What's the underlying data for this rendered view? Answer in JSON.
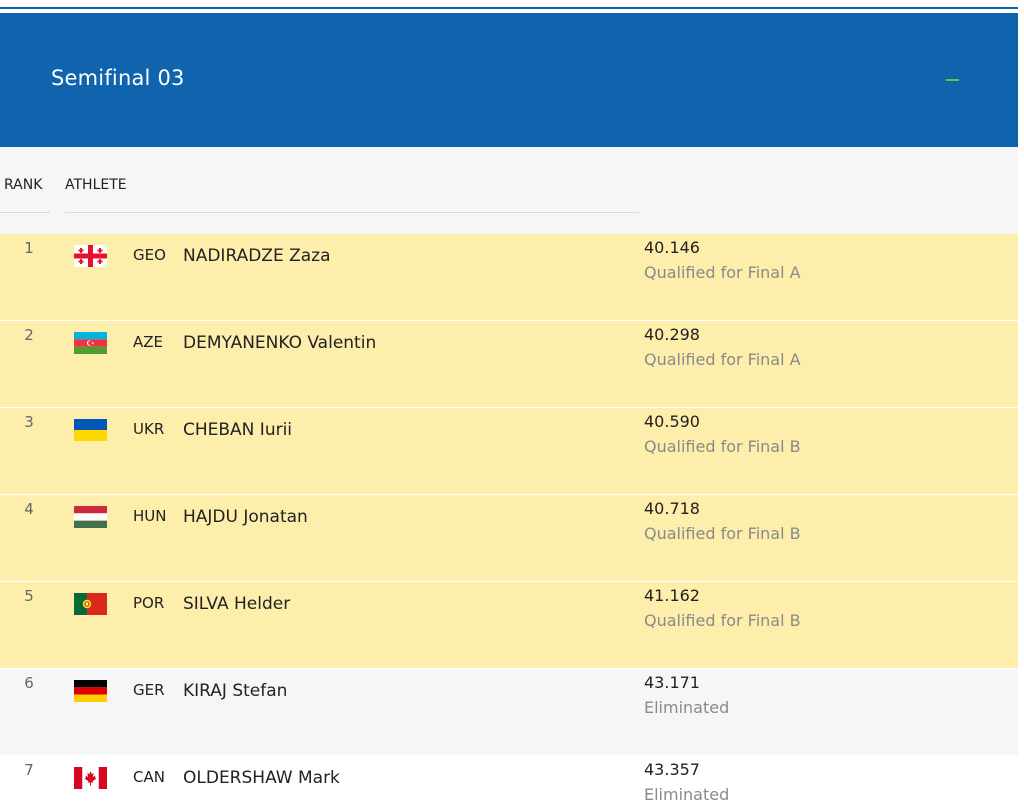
{
  "header": {
    "title": "Semifinal 03",
    "collapse_icon": "minus-icon",
    "background": "#0f64ad",
    "accent": "#6dbf4b"
  },
  "columns": {
    "rank": "RANK",
    "athlete": "ATHLETE"
  },
  "colors": {
    "qualified_row": "#fdeeac",
    "status_text": "#8a8a8a"
  },
  "results": [
    {
      "rank": "1",
      "flag": "flag-geo-icon",
      "code": "GEO",
      "name": "NADIRADZE Zaza",
      "time": "40.146",
      "status": "Qualified for Final A"
    },
    {
      "rank": "2",
      "flag": "flag-aze-icon",
      "code": "AZE",
      "name": "DEMYANENKO Valentin",
      "time": "40.298",
      "status": "Qualified for Final A"
    },
    {
      "rank": "3",
      "flag": "flag-ukr-icon",
      "code": "UKR",
      "name": "CHEBAN Iurii",
      "time": "40.590",
      "status": "Qualified for Final B"
    },
    {
      "rank": "4",
      "flag": "flag-hun-icon",
      "code": "HUN",
      "name": "HAJDU Jonatan",
      "time": "40.718",
      "status": "Qualified for Final B"
    },
    {
      "rank": "5",
      "flag": "flag-por-icon",
      "code": "POR",
      "name": "SILVA Helder",
      "time": "41.162",
      "status": "Qualified for Final B"
    },
    {
      "rank": "6",
      "flag": "flag-ger-icon",
      "code": "GER",
      "name": "KIRAJ Stefan",
      "time": "43.171",
      "status": "Eliminated"
    },
    {
      "rank": "7",
      "flag": "flag-can-icon",
      "code": "CAN",
      "name": "OLDERSHAW Mark",
      "time": "43.357",
      "status": "Eliminated"
    }
  ]
}
